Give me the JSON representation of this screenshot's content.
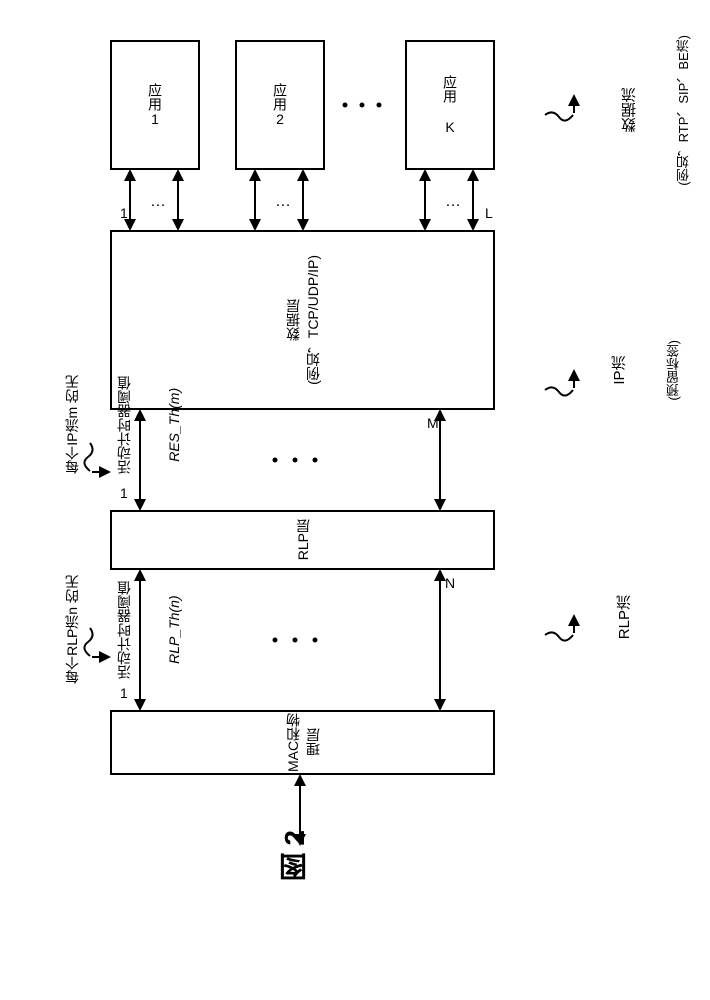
{
  "apps": {
    "app1": "应用1",
    "app2": "应用2",
    "appK": "应用 K"
  },
  "layers": {
    "data_line1": "数据层",
    "data_line2": "(例如，TCP/UDP/IP)",
    "rlp": "RLP层",
    "mac": "MAC和物理层"
  },
  "rightLabels": {
    "dataflow1": "数据流",
    "dataflow2": "(例如，RTP、SIP、BE流)",
    "ipflow1": "IP流",
    "ipflow2": "(预留标签)",
    "rlpflow": "RLP流"
  },
  "counts": {
    "one_a": "1",
    "L": "L",
    "one_b": "1",
    "M": "M",
    "one_c": "1",
    "N": "N"
  },
  "leftNotes": {
    "ip_line1": "每个IP流m 的无",
    "ip_line2": "活动计时器阈值",
    "ip_line3": "RES_Th(m)",
    "rlp_line1": "每个RLP流n 的无",
    "rlp_line2": "活动计时器阈值",
    "rlp_line3": "RLP_Th(n)"
  },
  "figure": "图 2"
}
